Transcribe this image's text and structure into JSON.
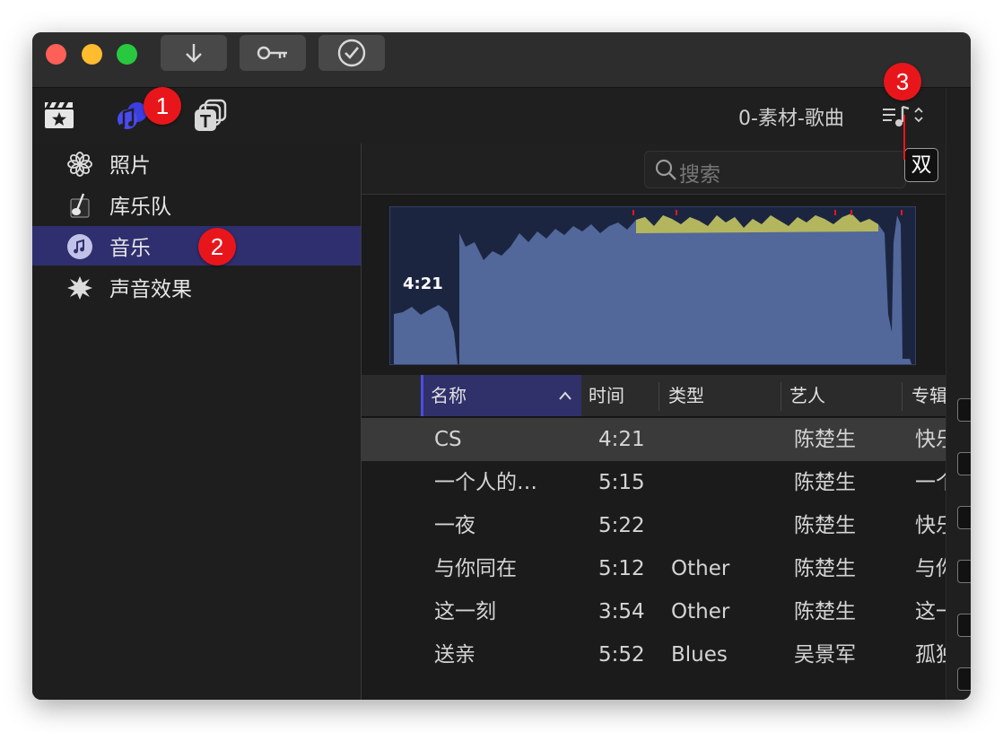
{
  "toolbar2": {
    "project_title": "0-素材-歌曲"
  },
  "sidebar": {
    "items": [
      {
        "label": "照片",
        "icon": "photos-icon"
      },
      {
        "label": "库乐队",
        "icon": "garageband-icon"
      },
      {
        "label": "音乐",
        "icon": "music-icon",
        "selected": true
      },
      {
        "label": "声音效果",
        "icon": "sound-effects-icon"
      }
    ]
  },
  "browser": {
    "search_placeholder": "搜索",
    "dual_button": "双",
    "waveform_time": "4:21",
    "columns": [
      "名称",
      "时间",
      "类型",
      "艺人",
      "专辑"
    ],
    "rows": [
      {
        "name": "CS",
        "time": "4:21",
        "type": "",
        "artist": "陈楚生",
        "album": "快乐"
      },
      {
        "name": "一个人的…",
        "time": "5:15",
        "type": "",
        "artist": "陈楚生",
        "album": "一个"
      },
      {
        "name": "一夜",
        "time": "5:22",
        "type": "",
        "artist": "陈楚生",
        "album": "快乐"
      },
      {
        "name": "与你同在",
        "time": "5:12",
        "type": "Other",
        "artist": "陈楚生",
        "album": "与你"
      },
      {
        "name": "这一刻",
        "time": "3:54",
        "type": "Other",
        "artist": "陈楚生",
        "album": "这一"
      },
      {
        "name": "送亲",
        "time": "5:52",
        "type": "Blues",
        "artist": "吴景军",
        "album": "孤独"
      }
    ]
  },
  "annotations": [
    "1",
    "2",
    "3"
  ],
  "colors": {
    "selection": "#2f2f70",
    "badge": "#e8161b",
    "waveform_fill": "#52679a",
    "waveform_peak": "#d6d04a"
  }
}
